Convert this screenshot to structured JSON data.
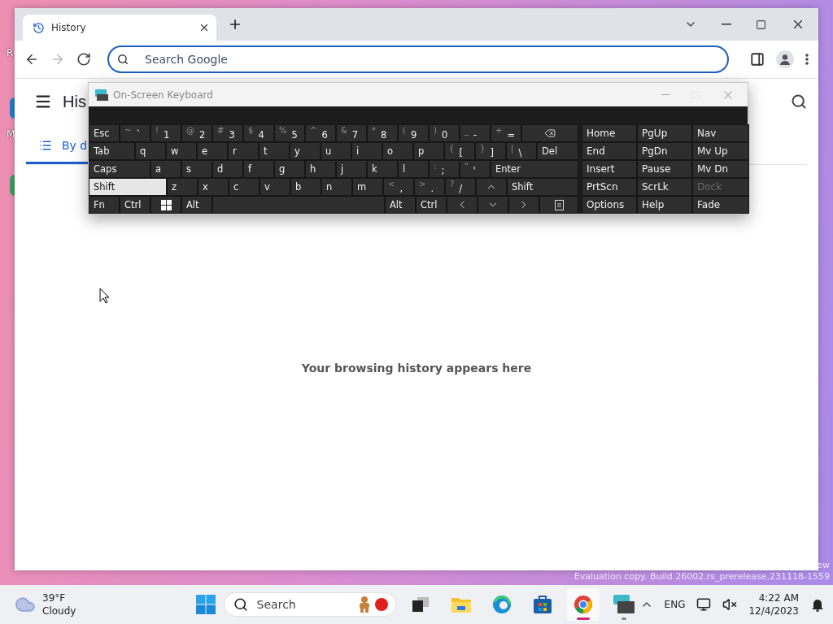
{
  "desktop": {
    "icon_labels": [
      "R",
      "M"
    ]
  },
  "browser": {
    "tabs": [
      {
        "title": "History",
        "selected": true
      }
    ],
    "nav_buttons": [
      {
        "kind": "back",
        "disabled": false
      },
      {
        "kind": "forward",
        "disabled": true
      },
      {
        "kind": "reload",
        "disabled": false
      }
    ],
    "omnibox": {
      "placeholder": "Search Google"
    },
    "page": {
      "title": "His",
      "tabs": [
        {
          "label": "By d",
          "selected": true
        }
      ],
      "empty_message": "Your browsing history appears here"
    }
  },
  "osk": {
    "title": "On-Screen Keyboard",
    "rows": [
      [
        {
          "kind": "key",
          "label": "Esc",
          "on": false
        },
        {
          "kind": "key",
          "label": "`",
          "shift": "~",
          "on": false
        },
        {
          "kind": "key",
          "label": "1",
          "shift": "!",
          "on": false
        },
        {
          "kind": "key",
          "label": "2",
          "shift": "@",
          "on": false
        },
        {
          "kind": "key",
          "label": "3",
          "shift": "#",
          "on": false
        },
        {
          "kind": "key",
          "label": "4",
          "shift": "$",
          "on": false
        },
        {
          "kind": "key",
          "label": "5",
          "shift": "%",
          "on": false
        },
        {
          "kind": "key",
          "label": "6",
          "shift": "^",
          "on": false
        },
        {
          "kind": "key",
          "label": "7",
          "shift": "&",
          "on": false
        },
        {
          "kind": "key",
          "label": "8",
          "shift": "*",
          "on": false
        },
        {
          "kind": "key",
          "label": "9",
          "shift": "(",
          "on": false
        },
        {
          "kind": "key",
          "label": "0",
          "shift": ")",
          "on": false
        },
        {
          "kind": "key",
          "label": "-",
          "shift": "_",
          "on": false
        },
        {
          "kind": "key",
          "label": "=",
          "shift": "+",
          "on": false
        },
        {
          "kind": "backspace",
          "on": false
        }
      ],
      [
        {
          "kind": "key",
          "label": "Tab",
          "on": false
        },
        {
          "kind": "key",
          "label": "q",
          "on": false
        },
        {
          "kind": "key",
          "label": "w",
          "on": false
        },
        {
          "kind": "key",
          "label": "e",
          "on": false
        },
        {
          "kind": "key",
          "label": "r",
          "on": false
        },
        {
          "kind": "key",
          "label": "t",
          "on": false
        },
        {
          "kind": "key",
          "label": "y",
          "on": false
        },
        {
          "kind": "key",
          "label": "u",
          "on": false
        },
        {
          "kind": "key",
          "label": "i",
          "on": false
        },
        {
          "kind": "key",
          "label": "o",
          "on": false
        },
        {
          "kind": "key",
          "label": "p",
          "on": false
        },
        {
          "kind": "key",
          "label": "[",
          "shift": "{",
          "on": false
        },
        {
          "kind": "key",
          "label": "]",
          "shift": "}",
          "on": false
        },
        {
          "kind": "key",
          "label": "\\",
          "shift": "|",
          "on": false
        },
        {
          "kind": "key",
          "label": "Del",
          "on": false
        }
      ],
      [
        {
          "kind": "key",
          "label": "Caps",
          "on": false
        },
        {
          "kind": "key",
          "label": "a",
          "on": false
        },
        {
          "kind": "key",
          "label": "s",
          "on": false
        },
        {
          "kind": "key",
          "label": "d",
          "on": false
        },
        {
          "kind": "key",
          "label": "f",
          "on": false
        },
        {
          "kind": "key",
          "label": "g",
          "on": false
        },
        {
          "kind": "key",
          "label": "h",
          "on": false
        },
        {
          "kind": "key",
          "label": "j",
          "on": false
        },
        {
          "kind": "key",
          "label": "k",
          "on": false
        },
        {
          "kind": "key",
          "label": "l",
          "on": false
        },
        {
          "kind": "key",
          "label": ";",
          "shift": ":",
          "on": false
        },
        {
          "kind": "key",
          "label": "'",
          "shift": "\"",
          "on": false
        },
        {
          "kind": "key",
          "label": "Enter",
          "on": false
        }
      ],
      [
        {
          "kind": "key",
          "label": "Shift",
          "on": true
        },
        {
          "kind": "key",
          "label": "z",
          "on": false
        },
        {
          "kind": "key",
          "label": "x",
          "on": false
        },
        {
          "kind": "key",
          "label": "c",
          "on": false
        },
        {
          "kind": "key",
          "label": "v",
          "on": false
        },
        {
          "kind": "key",
          "label": "b",
          "on": false
        },
        {
          "kind": "key",
          "label": "n",
          "on": false
        },
        {
          "kind": "key",
          "label": "m",
          "on": false
        },
        {
          "kind": "key",
          "label": ",",
          "shift": "<",
          "on": false
        },
        {
          "kind": "key",
          "label": ".",
          "shift": ">",
          "on": false
        },
        {
          "kind": "key",
          "label": "/",
          "shift": "?",
          "on": false
        },
        {
          "kind": "up",
          "on": false
        },
        {
          "kind": "key",
          "label": "Shift",
          "on": false
        }
      ],
      [
        {
          "kind": "key",
          "label": "Fn",
          "on": false
        },
        {
          "kind": "key",
          "label": "Ctrl",
          "on": false
        },
        {
          "kind": "windows",
          "on": false
        },
        {
          "kind": "key",
          "label": "Alt",
          "on": false
        },
        {
          "kind": "space",
          "on": false
        },
        {
          "kind": "key",
          "label": "Alt",
          "on": false
        },
        {
          "kind": "key",
          "label": "Ctrl",
          "on": false
        },
        {
          "kind": "left",
          "on": false
        },
        {
          "kind": "down",
          "on": false
        },
        {
          "kind": "right",
          "on": false
        },
        {
          "kind": "menu",
          "on": false
        }
      ]
    ],
    "nav_keys": [
      {
        "label": "Home",
        "disabled": false
      },
      {
        "label": "PgUp",
        "disabled": false
      },
      {
        "label": "Nav",
        "disabled": false
      },
      {
        "label": "End",
        "disabled": false
      },
      {
        "label": "PgDn",
        "disabled": false
      },
      {
        "label": "Mv Up",
        "disabled": false
      },
      {
        "label": "Insert",
        "disabled": false
      },
      {
        "label": "Pause",
        "disabled": false
      },
      {
        "label": "Mv Dn",
        "disabled": false
      },
      {
        "label": "PrtScn",
        "disabled": false
      },
      {
        "label": "ScrLk",
        "disabled": false
      },
      {
        "label": "Dock",
        "disabled": true
      },
      {
        "label": "Options",
        "disabled": false
      },
      {
        "label": "Help",
        "disabled": false
      },
      {
        "label": "Fade",
        "disabled": false
      }
    ]
  },
  "watermark": [
    "ew",
    "Evaluation copy. Build 26002.rs_prerelease.231118-1559"
  ],
  "taskbar": {
    "weather": {
      "temperature": "39°F",
      "condition": "Cloudy"
    },
    "search": {
      "placeholder": "Search"
    },
    "apps": [
      {
        "kind": "taskview",
        "active": false,
        "running": false
      },
      {
        "kind": "files",
        "active": false,
        "running": false
      },
      {
        "kind": "edge",
        "active": false,
        "running": false
      },
      {
        "kind": "store",
        "active": false,
        "running": false
      },
      {
        "kind": "chrome",
        "active": true,
        "running": true
      },
      {
        "kind": "keyboard",
        "active": false,
        "running": true
      }
    ],
    "language": "ENG",
    "time": "4:22 AM",
    "date": "12/4/2023"
  }
}
